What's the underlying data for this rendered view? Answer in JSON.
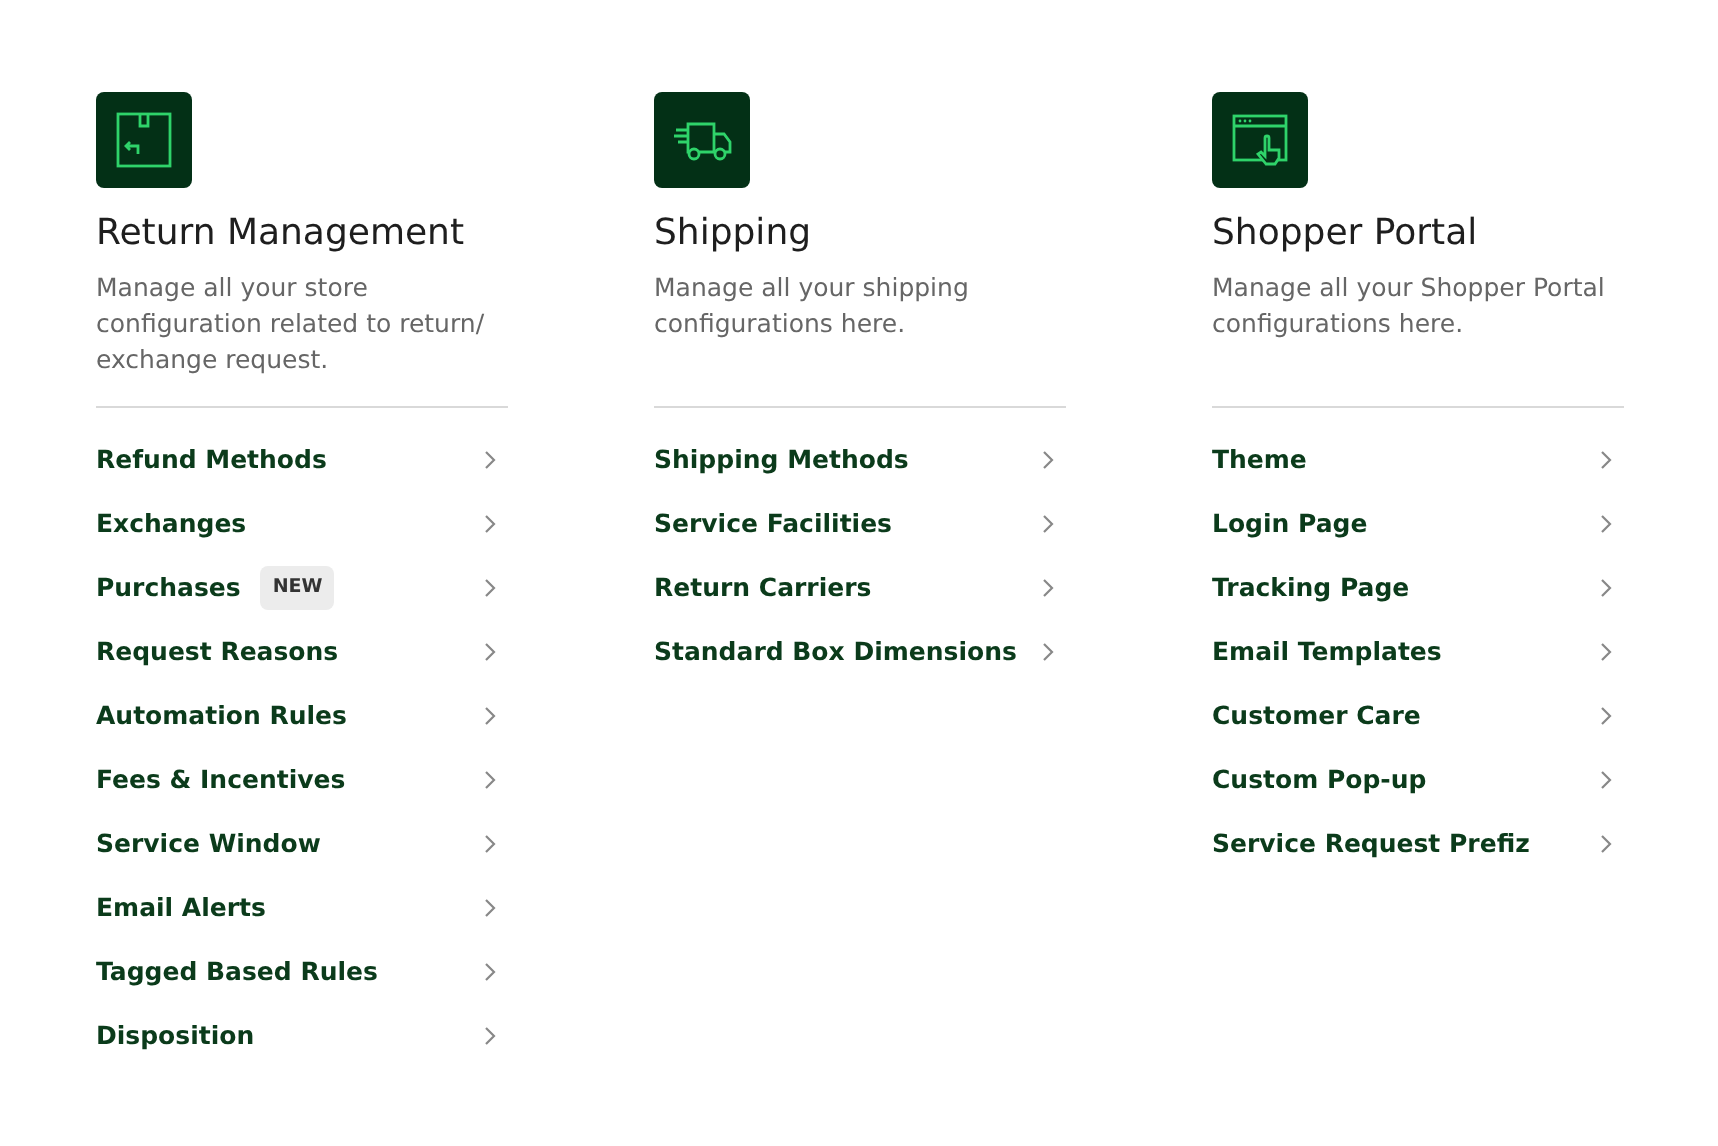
{
  "sections": [
    {
      "kind": "return-box",
      "title": "Return Management",
      "description": "Manage all your store configuration related to return/ exchange request.",
      "items": [
        {
          "label": "Refund Methods"
        },
        {
          "label": "Exchanges"
        },
        {
          "label": "Purchases",
          "badge": "NEW"
        },
        {
          "label": "Request Reasons"
        },
        {
          "label": "Automation Rules"
        },
        {
          "label": "Fees & Incentives"
        },
        {
          "label": "Service Window"
        },
        {
          "label": "Email Alerts"
        },
        {
          "label": "Tagged Based Rules"
        },
        {
          "label": "Disposition"
        }
      ]
    },
    {
      "kind": "truck",
      "title": "Shipping",
      "description": "Manage all your shipping configurations here.",
      "items": [
        {
          "label": "Shipping Methods"
        },
        {
          "label": "Service Facilities"
        },
        {
          "label": "Return Carriers"
        },
        {
          "label": "Standard Box Dimensions"
        }
      ]
    },
    {
      "kind": "browser-pointer",
      "title": "Shopper Portal",
      "description": "Manage all your Shopper Portal configurations here.",
      "items": [
        {
          "label": "Theme"
        },
        {
          "label": "Login Page"
        },
        {
          "label": "Tracking Page"
        },
        {
          "label": "Email Templates"
        },
        {
          "label": "Customer Care"
        },
        {
          "label": "Custom Pop-up"
        },
        {
          "label": "Service Request Prefiz"
        }
      ]
    }
  ]
}
